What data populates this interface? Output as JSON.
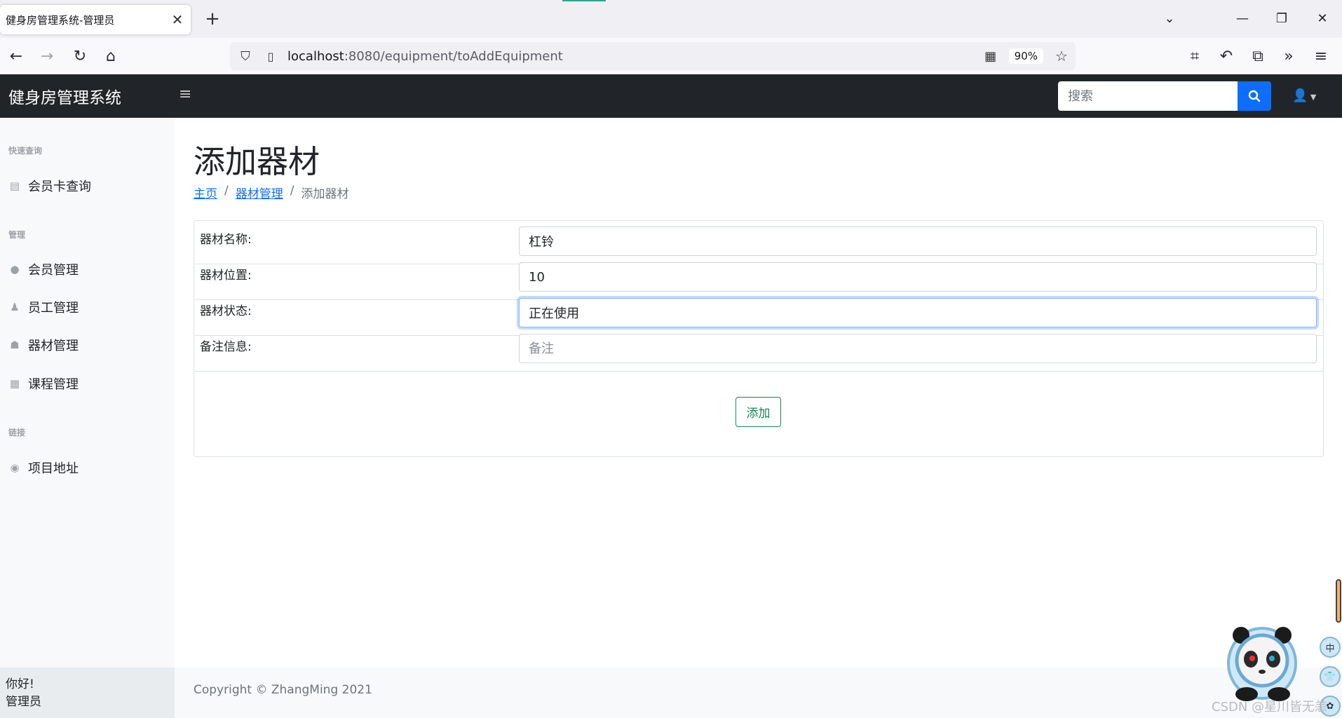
{
  "browser": {
    "tab_title": "健身房管理系统-管理员",
    "url_host": "localhost",
    "url_rest": ":8080/equipment/toAddEquipment",
    "zoom": "90%"
  },
  "app": {
    "brand": "健身房管理系统",
    "search_placeholder": "搜索"
  },
  "sidebar": {
    "sections": [
      {
        "heading": "快速查询",
        "items": [
          {
            "label": "会员卡查询",
            "icon": "id-card-icon"
          }
        ]
      },
      {
        "heading": "管理",
        "items": [
          {
            "label": "会员管理",
            "icon": "user-icon"
          },
          {
            "label": "员工管理",
            "icon": "user-tie-icon"
          },
          {
            "label": "器材管理",
            "icon": "equipment-icon"
          },
          {
            "label": "课程管理",
            "icon": "calendar-icon"
          }
        ]
      },
      {
        "heading": "链接",
        "items": [
          {
            "label": "项目地址",
            "icon": "github-icon"
          }
        ]
      }
    ],
    "greeting": "你好!",
    "role": "管理员"
  },
  "main": {
    "title": "添加器材",
    "breadcrumb": [
      "主页",
      "器材管理",
      "添加器材"
    ],
    "form": {
      "rows": [
        {
          "label": "器材名称:",
          "value": "杠铃",
          "placeholder": ""
        },
        {
          "label": "器材位置:",
          "value": "10",
          "placeholder": ""
        },
        {
          "label": "器材状态:",
          "value": "正在使用",
          "placeholder": ""
        },
        {
          "label": "备注信息:",
          "value": "",
          "placeholder": "备注"
        }
      ],
      "submit_label": "添加"
    },
    "footer": "Copyright © ZhangMing 2021"
  },
  "overlay": {
    "watermark": "CSDN @星川皆无恙",
    "widget_1": "中"
  },
  "colors": {
    "topbar": "#212529",
    "primary": "#0d6efd",
    "success": "#198754",
    "sidebar_bg": "#f8f9fa"
  }
}
